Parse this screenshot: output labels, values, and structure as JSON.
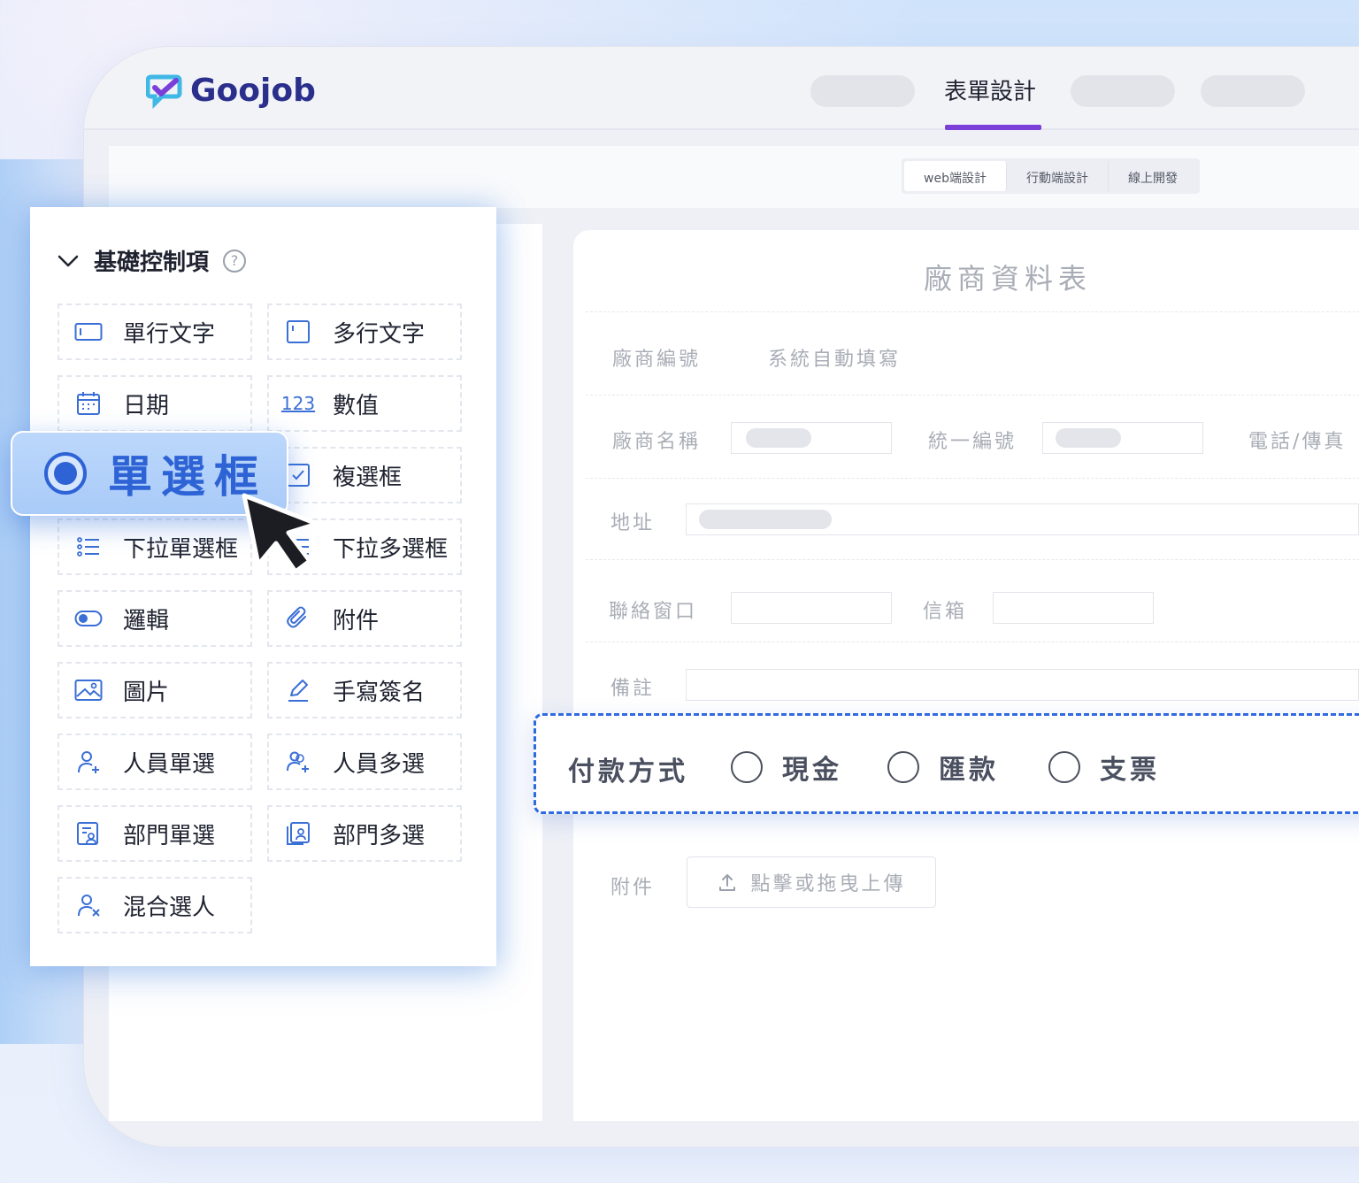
{
  "brand": {
    "name": "Goojob",
    "accent": "#7a3fd9",
    "primary": "#2e63d6"
  },
  "header": {
    "active_tab": "表單設計"
  },
  "subtabs": [
    "web端設計",
    "行動端設計",
    "線上開發"
  ],
  "panel": {
    "title": "基礎控制項",
    "controls": [
      {
        "label": "單行文字",
        "icon": "single-line-text-icon"
      },
      {
        "label": "多行文字",
        "icon": "multi-line-text-icon"
      },
      {
        "label": "日期",
        "icon": "calendar-icon"
      },
      {
        "label": "數值",
        "icon": "number-icon"
      },
      {
        "label": "複選框",
        "icon": "checkbox-icon"
      },
      {
        "label": "下拉單選框",
        "icon": "list-icon"
      },
      {
        "label": "下拉多選框",
        "icon": "list-multi-icon"
      },
      {
        "label": "邏輯",
        "icon": "toggle-icon"
      },
      {
        "label": "附件",
        "icon": "paperclip-icon"
      },
      {
        "label": "圖片",
        "icon": "image-icon"
      },
      {
        "label": "手寫簽名",
        "icon": "pen-icon"
      },
      {
        "label": "人員單選",
        "icon": "user-add-icon"
      },
      {
        "label": "人員多選",
        "icon": "users-add-icon"
      },
      {
        "label": "部門單選",
        "icon": "department-icon"
      },
      {
        "label": "部門多選",
        "icon": "departments-icon"
      },
      {
        "label": "混合選人",
        "icon": "user-mixed-icon"
      }
    ],
    "dragged": {
      "label": "單選框",
      "icon": "radio-icon"
    }
  },
  "form": {
    "title": "廠商資料表",
    "vendor_id_label": "廠商編號",
    "vendor_id_value": "系統自動填寫",
    "vendor_name_label": "廠商名稱",
    "tax_id_label": "統一編號",
    "phone_fax_label": "電話/傳真",
    "address_label": "地址",
    "contact_label": "聯絡窗口",
    "email_label": "信箱",
    "remarks_label": "備註",
    "payment": {
      "label": "付款方式",
      "options": [
        "現金",
        "匯款",
        "支票"
      ]
    },
    "attachment_label": "附件",
    "upload_text": "點擊或拖曳上傳"
  }
}
